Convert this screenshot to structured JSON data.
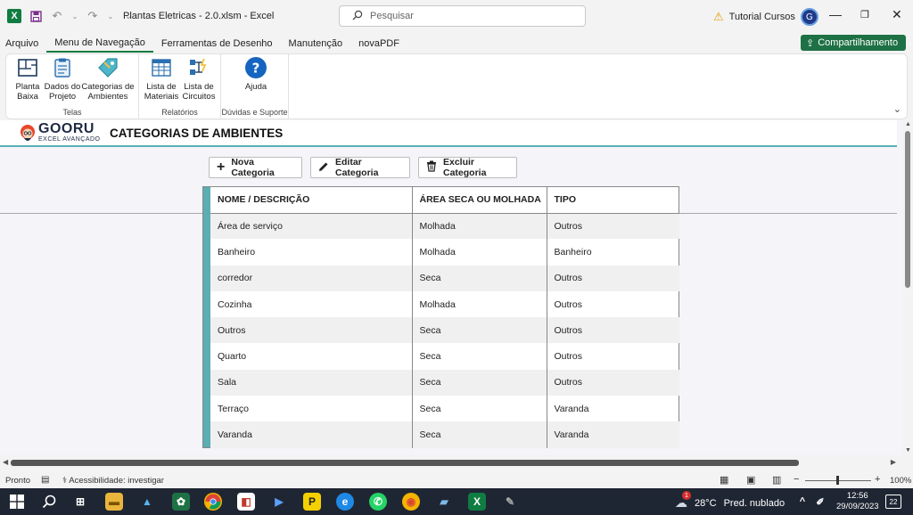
{
  "titlebar": {
    "document_title": "Plantas Eletricas - 2.0.xlsm  -  Excel",
    "search_placeholder": "Pesquisar",
    "user_name": "Tutorial Cursos",
    "avatar_initial": "G"
  },
  "menu": {
    "tabs": [
      "Arquivo",
      "Menu de Navegação",
      "Ferramentas de Desenho",
      "Manutenção",
      "novaPDF"
    ],
    "active_tab": "Menu de Navegação",
    "share_label": "Compartilhamento"
  },
  "ribbon": {
    "groups": [
      {
        "label": "Telas",
        "buttons": [
          {
            "label_1": "Planta",
            "label_2": "Baixa",
            "icon": "floorplan-icon"
          },
          {
            "label_1": "Dados do",
            "label_2": "Projeto",
            "icon": "clipboard-icon"
          },
          {
            "label_1": "Categorias de",
            "label_2": "Ambientes",
            "icon": "tag-icon"
          }
        ]
      },
      {
        "label": "Relatórios",
        "buttons": [
          {
            "label_1": "Lista de",
            "label_2": "Materiais",
            "icon": "table-icon"
          },
          {
            "label_1": "Lista de",
            "label_2": "Circuitos",
            "icon": "circuit-icon"
          }
        ]
      },
      {
        "label": "Dúvidas e Suporte",
        "buttons": [
          {
            "label_1": "Ajuda",
            "label_2": "",
            "icon": "help-icon"
          }
        ]
      }
    ]
  },
  "sheet": {
    "brand_name": "GOORU",
    "brand_subtitle": "EXCEL AVANÇADO",
    "page_title": "CATEGORIAS DE AMBIENTES",
    "toolbar": {
      "new_label": "Nova Categoria",
      "edit_label": "Editar Categoria",
      "delete_label": "Excluir Categoria"
    },
    "table": {
      "headers": [
        "NOME / DESCRIÇÃO",
        "ÁREA SECA OU MOLHADA",
        "TIPO"
      ],
      "rows": [
        [
          "Área de serviço",
          "Molhada",
          "Outros"
        ],
        [
          "Banheiro",
          "Molhada",
          "Banheiro"
        ],
        [
          "corredor",
          "Seca",
          "Outros"
        ],
        [
          "Cozinha",
          "Molhada",
          "Outros"
        ],
        [
          "Outros",
          "Seca",
          "Outros"
        ],
        [
          "Quarto",
          "Seca",
          "Outros"
        ],
        [
          "Sala",
          "Seca",
          "Outros"
        ],
        [
          "Terraço",
          "Seca",
          "Varanda"
        ],
        [
          "Varanda",
          "Seca",
          "Varanda"
        ]
      ]
    }
  },
  "statusbar": {
    "ready": "Pronto",
    "accessibility": "Acessibilidade: investigar",
    "zoom": "100%"
  },
  "taskbar": {
    "weather_temp": "28°C",
    "weather_desc": "Pred. nublado",
    "time": "12:56",
    "date": "29/09/2023",
    "notifications": "22",
    "weather_badge": "1"
  },
  "colors": {
    "excel_green": "#107c41",
    "accent_teal": "#5aaeb4",
    "brand_navy": "#1e2a44",
    "gooru_orange": "#e8472b"
  }
}
